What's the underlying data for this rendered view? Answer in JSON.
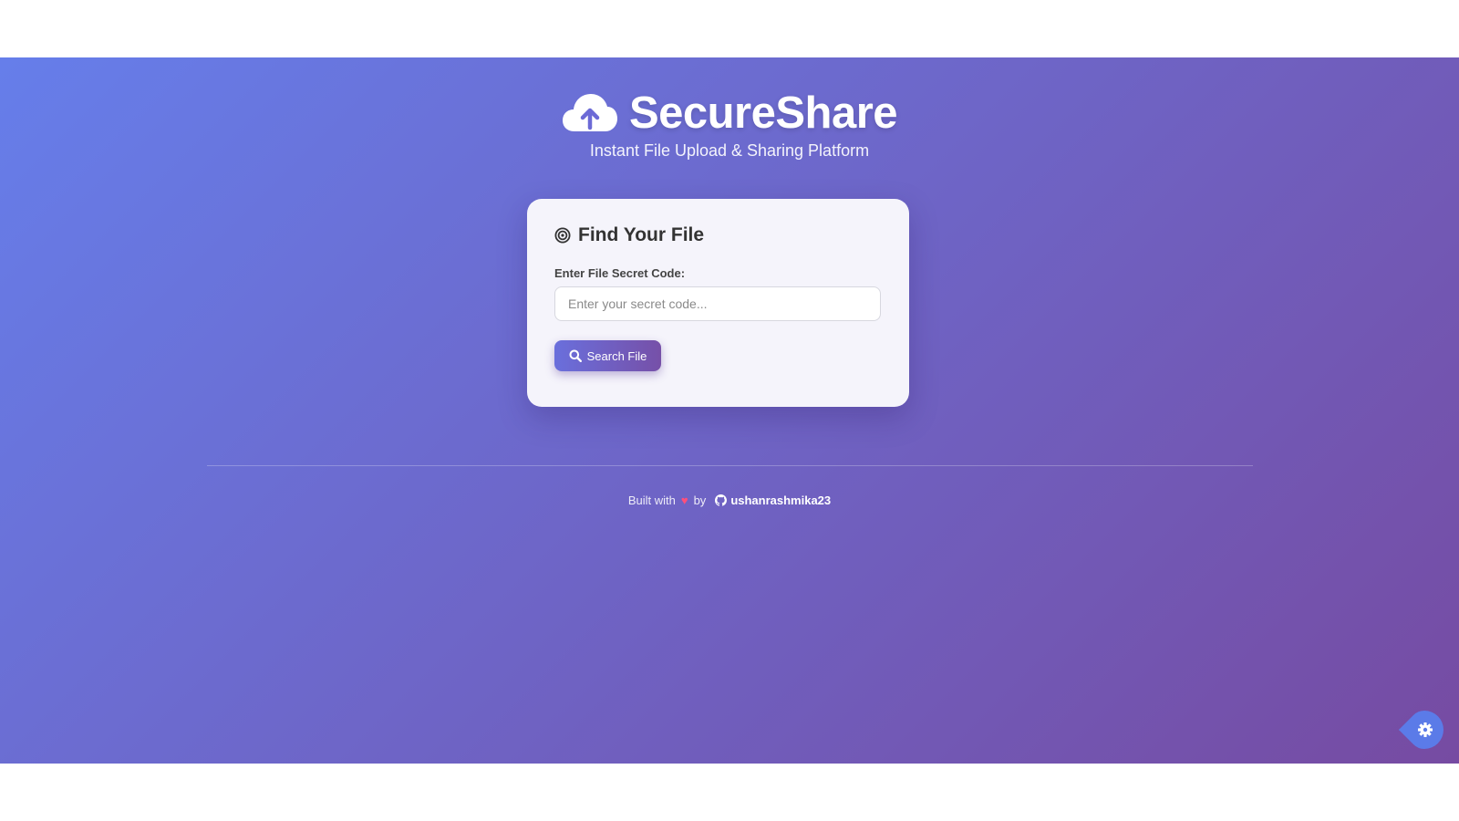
{
  "app": {
    "name": "SecureShare",
    "tagline": "Instant File Upload & Sharing Platform"
  },
  "find_card": {
    "title": "Find Your File",
    "field_label": "Enter File Secret Code:",
    "input_value": "",
    "input_placeholder": "Enter your secret code...",
    "search_button_label": "Search File"
  },
  "footer": {
    "built_with": "Built with",
    "heart": "♥",
    "by": "by",
    "github_user": "ushanrashmika23"
  },
  "icons": {
    "brand": "cloud-upload-icon",
    "card_title": "target-icon",
    "search": "search-icon",
    "footer_heart": "heart-icon",
    "footer_github": "github-icon",
    "settings": "gear-icon"
  },
  "colors": {
    "gradient_start": "#667eea",
    "gradient_end": "#764ba2",
    "card_background": "#f5f4fb",
    "heart": "#ff4f7b",
    "fab": "#5b7be8"
  }
}
